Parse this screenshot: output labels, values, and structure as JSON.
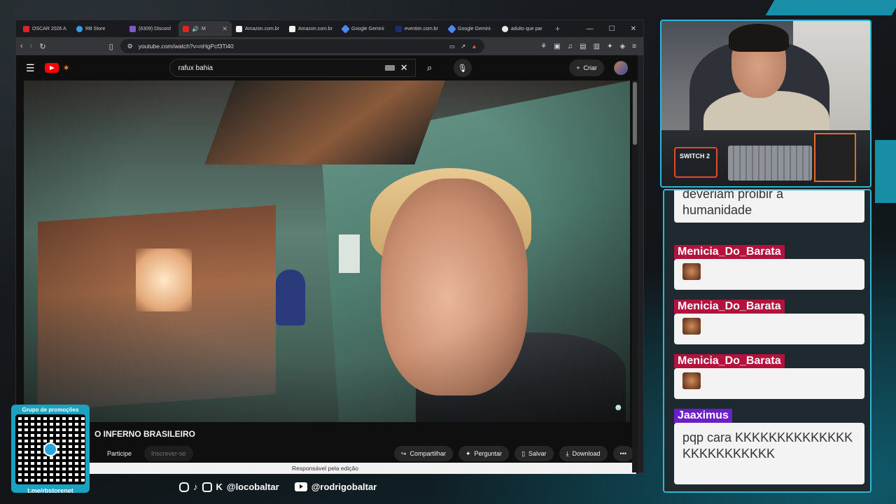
{
  "browser": {
    "tabs": [
      {
        "label": "OSCAR 2026 A",
        "color": "#e02424",
        "active": false
      },
      {
        "label": "RB Store",
        "color": "#2aa6de",
        "active": false
      },
      {
        "label": "(6309) Discord",
        "color": "#7c5cc4",
        "active": false
      },
      {
        "label": "M",
        "color": "#e02424",
        "active": true
      },
      {
        "label": "Amazon.com.br",
        "color": "#f1f1f1",
        "active": false
      },
      {
        "label": "Amazon.com.br",
        "color": "#f1f1f1",
        "active": false
      },
      {
        "label": "Google Gemini",
        "color": "#4b8af5",
        "active": false
      },
      {
        "label": "eventim.com.br",
        "color": "#1d2f6b",
        "active": false
      },
      {
        "label": "Google Gemini",
        "color": "#4b8af5",
        "active": false
      },
      {
        "label": "adulto que par",
        "color": "#e8e8e8",
        "active": false
      }
    ],
    "url": "youtube.com/watch?v=nHgPcf3Ti40"
  },
  "youtube": {
    "search_value": "rafux bahia",
    "create_label": "Criar",
    "video_title": "O INFERNO BRASILEIRO",
    "join_label": "Participe",
    "subscribe_label": "Inscrever-se",
    "share_label": "Compartilhar",
    "ask_label": "Perguntar",
    "save_label": "Salvar",
    "download_label": "Download",
    "edit_notice": "Responsável pela edição"
  },
  "chat": {
    "messages": [
      {
        "user": "",
        "text": "deveriam proibir a humanidade",
        "user_color": "",
        "emote": false
      },
      {
        "user": "Menicia_Do_Barata",
        "text": "",
        "user_color": "#b3123d",
        "emote": true
      },
      {
        "user": "Menicia_Do_Barata",
        "text": "",
        "user_color": "#b3123d",
        "emote": true
      },
      {
        "user": "Menicia_Do_Barata",
        "text": "",
        "user_color": "#b3123d",
        "emote": true
      },
      {
        "user": "Jaaximus",
        "text": "pqp cara KKKKKKKKKKKKKKKKKKKKKKKKK",
        "user_color": "#6a1fc9",
        "emote": false
      }
    ]
  },
  "overlay": {
    "qr_title": "Grupo de promoções",
    "qr_link": "t.me/rbstorenet",
    "social_handle_1": "@locobaltar",
    "social_handle_2": "@rodrigobaltar",
    "switch_label": "SWITCH 2"
  },
  "colors": {
    "accent": "#2fb7d4",
    "youtube_red": "#ff0000"
  }
}
